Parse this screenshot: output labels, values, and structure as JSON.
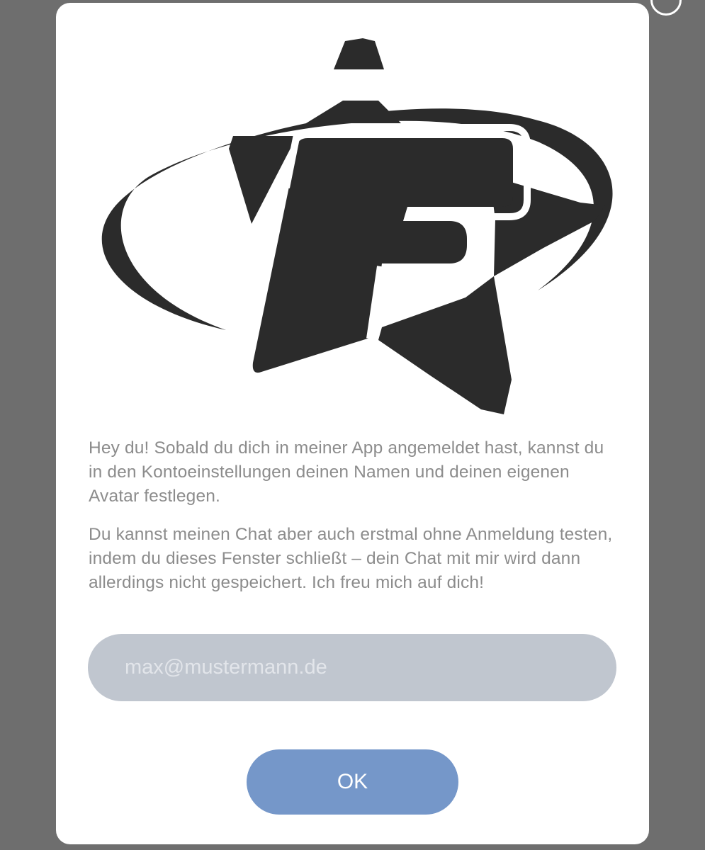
{
  "dialog": {
    "message_paragraph_1": "Hey du! Sobald du dich in meiner App angemeldet hast, kannst du in den Kontoeinstellungen deinen Namen und deinen eigenen Avatar festlegen.",
    "message_paragraph_2": "Du kannst meinen Chat aber auch erstmal ohne Anmeldung testen, indem du dieses Fenster schließt – dein Chat mit mir wird dann allerdings nicht gespeichert. Ich freu mich auf dich!",
    "email_placeholder": "max@mustermann.de",
    "email_value": "",
    "ok_label": "OK"
  },
  "logo": {
    "icon": "star-f-logo",
    "color": "#2b2b2b"
  },
  "colors": {
    "overlay": "#6e6e6e",
    "dialog_background": "#ffffff",
    "message_text": "#8c8c8c",
    "input_background": "#c0c6cf",
    "button_background": "#7597c9",
    "button_text": "#ffffff"
  }
}
